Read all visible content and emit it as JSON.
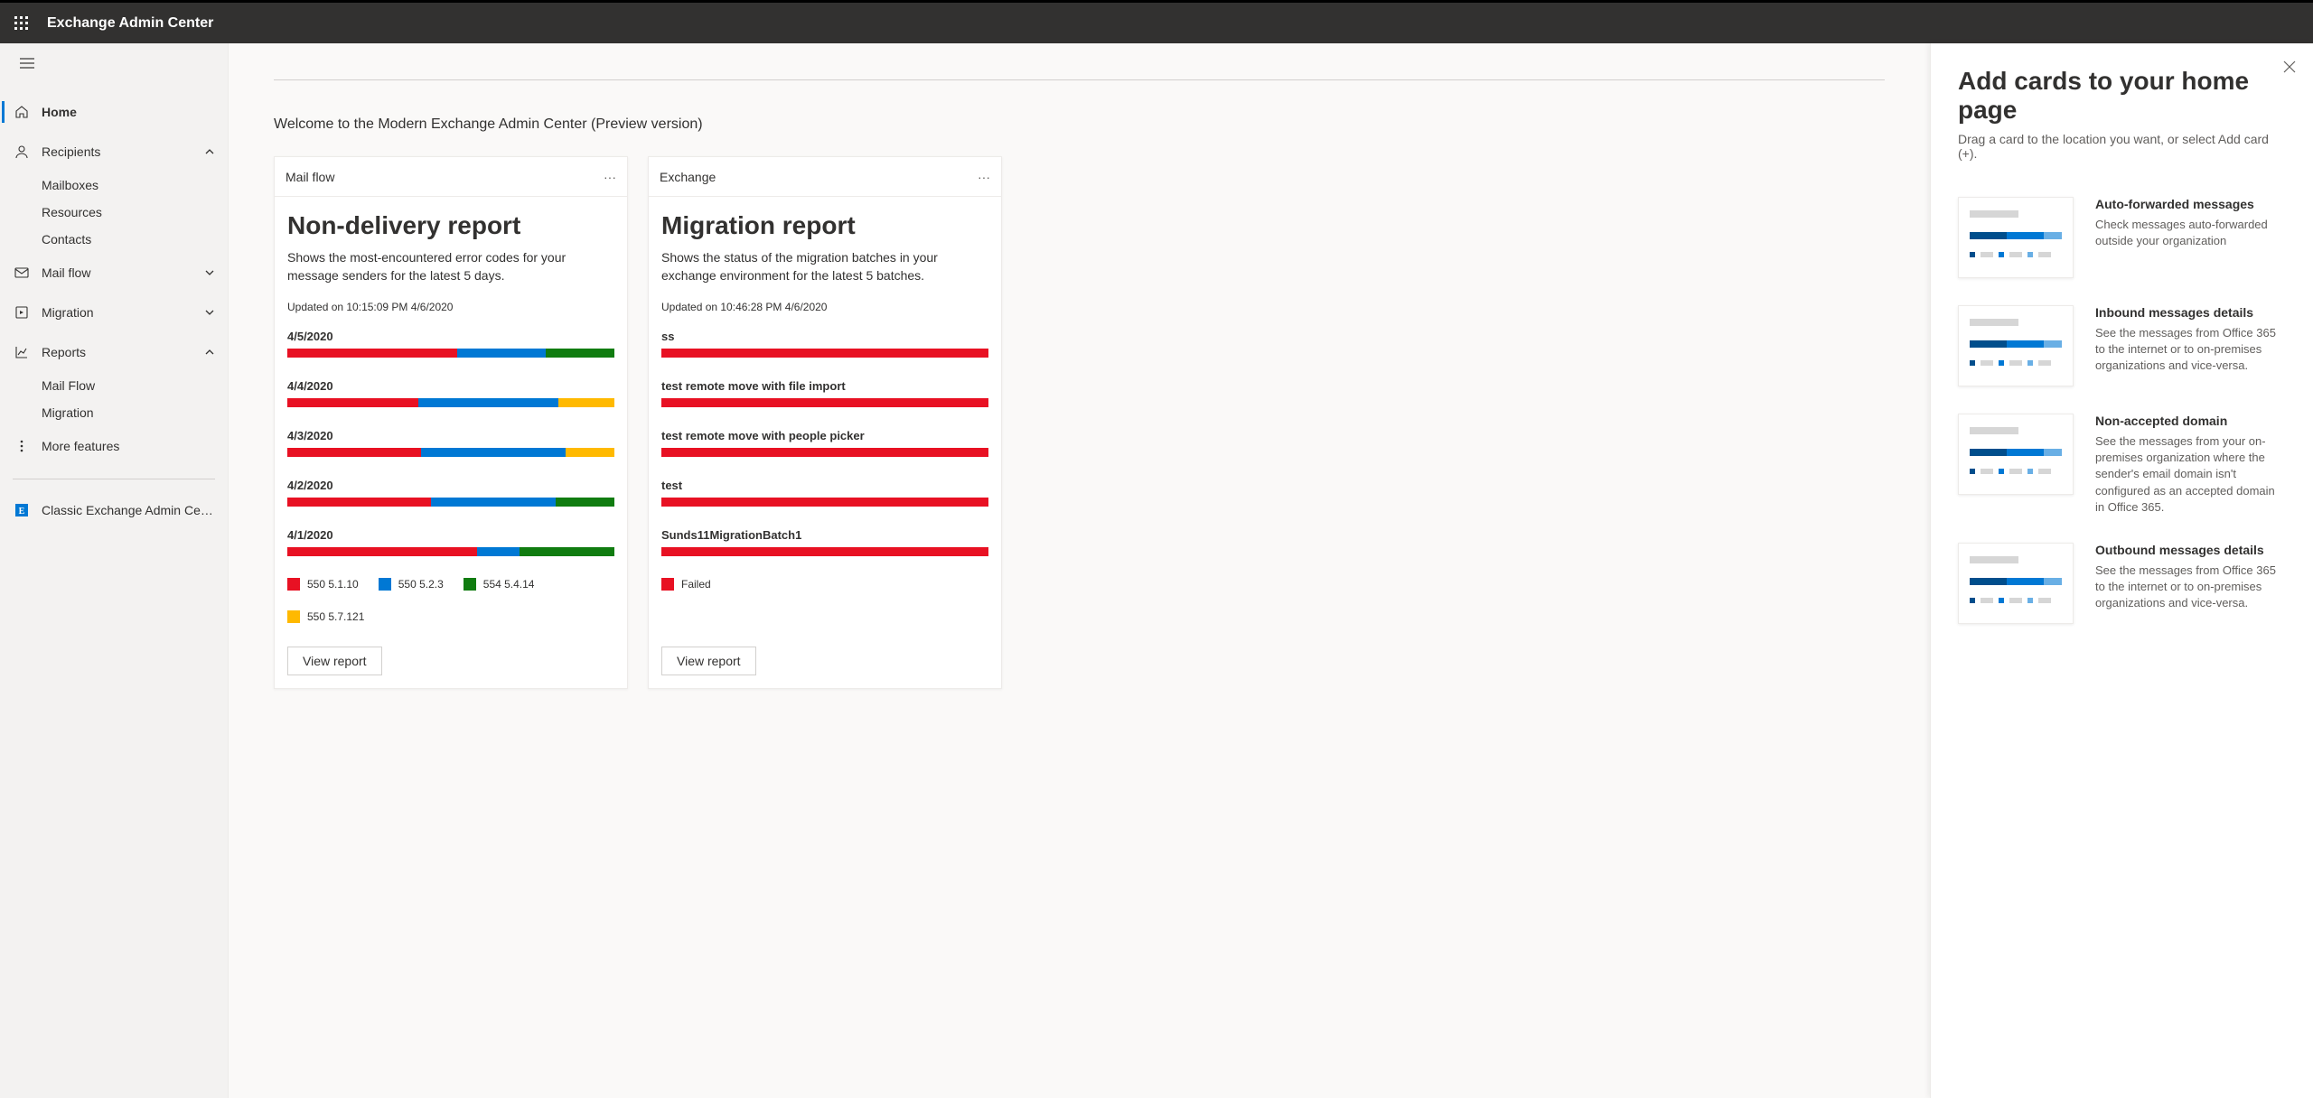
{
  "header": {
    "title": "Exchange Admin Center"
  },
  "sidebar": {
    "home": "Home",
    "recipients": "Recipients",
    "recipients_children": [
      "Mailboxes",
      "Resources",
      "Contacts"
    ],
    "mailflow": "Mail flow",
    "migration": "Migration",
    "reports": "Reports",
    "reports_children": [
      "Mail Flow",
      "Migration"
    ],
    "more": "More features",
    "classic": "Classic Exchange Admin Cent..."
  },
  "main": {
    "welcome": "Welcome to the Modern Exchange Admin Center (Preview version)"
  },
  "card_ndr": {
    "header": "Mail flow",
    "title": "Non-delivery report",
    "desc": "Shows the most-encountered error codes for your message senders for the latest 5 days.",
    "updated": "Updated on 10:15:09 PM 4/6/2020",
    "button": "View report"
  },
  "card_mig": {
    "header": "Exchange",
    "title": "Migration report",
    "desc": "Shows the status of the migration batches in your exchange environment for the latest 5 batches.",
    "updated": "Updated on 10:46:28 PM 4/6/2020",
    "button": "View report"
  },
  "panel": {
    "title": "Add cards to your home page",
    "sub": "Drag a card to the location you want, or select Add card (+).",
    "c1_title": "Auto-forwarded messages",
    "c1_desc": "Check messages auto-forwarded outside your organization",
    "c2_title": "Inbound messages details",
    "c2_desc": "See the messages from Office 365 to the internet or to on-premises organizations and vice-versa.",
    "c3_title": "Non-accepted domain",
    "c3_desc": "See the messages from your on-premises organization where the sender's email domain isn't configured as an accepted domain in Office 365.",
    "c4_title": "Outbound messages details",
    "c4_desc": "See the messages from Office 365 to the internet or to on-premises organizations and vice-versa."
  },
  "chart_data": [
    {
      "type": "bar",
      "title": "Non-delivery report",
      "xlabel": "",
      "ylabel": "",
      "ylim": [
        0,
        100
      ],
      "categories": [
        "4/5/2020",
        "4/4/2020",
        "4/3/2020",
        "4/2/2020",
        "4/1/2020"
      ],
      "series": [
        {
          "name": "550 5.1.10",
          "color": "#e81123",
          "values": [
            52,
            40,
            41,
            44,
            58
          ]
        },
        {
          "name": "550 5.2.3",
          "color": "#0078d4",
          "values": [
            27,
            43,
            44,
            38,
            13
          ]
        },
        {
          "name": "554 5.4.14",
          "color": "#107c10",
          "values": [
            21,
            0,
            0,
            18,
            29
          ]
        },
        {
          "name": "550 5.7.121",
          "color": "#ffb900",
          "values": [
            0,
            17,
            15,
            0,
            0
          ]
        }
      ]
    },
    {
      "type": "bar",
      "title": "Migration report",
      "xlabel": "",
      "ylabel": "",
      "ylim": [
        0,
        100
      ],
      "categories": [
        "ss",
        "test remote move with file import",
        "test remote move with people picker",
        "test",
        "Sunds11MigrationBatch1"
      ],
      "series": [
        {
          "name": "Failed",
          "color": "#e81123",
          "values": [
            100,
            100,
            100,
            100,
            100
          ]
        }
      ]
    }
  ]
}
